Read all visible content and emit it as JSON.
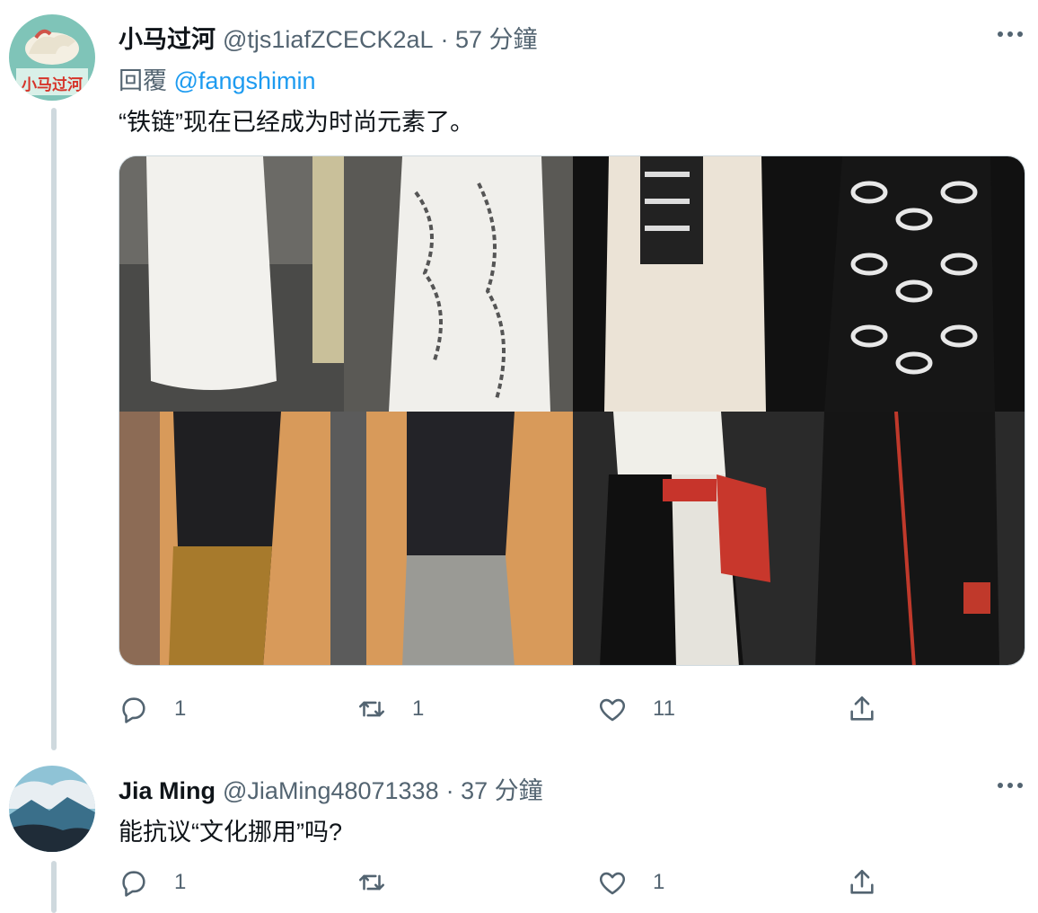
{
  "tweets": [
    {
      "display_name": "小马过河",
      "handle": "@tjs1iafZCECK2aL",
      "time": "· 57 分鐘",
      "reply_prefix": "回覆",
      "reply_mention": "@fangshimin",
      "text": "“铁链”现在已经成为时尚元素了。",
      "media_alt": [
        "runway-white-chain-dresses",
        "runway-black-chain-coat",
        "runway-ruched-dresses",
        "runway-leather-chain-looks"
      ],
      "actions": {
        "reply_count": "1",
        "retweet_count": "1",
        "like_count": "11"
      },
      "avatar_text": "小马过河"
    },
    {
      "display_name": "Jia Ming",
      "handle": "@JiaMing48071338",
      "time": "· 37 分鐘",
      "text": "能抗议“文化挪用”吗?",
      "actions": {
        "reply_count": "1",
        "retweet_count": "",
        "like_count": "1"
      }
    }
  ],
  "icons": [
    "reply-icon",
    "retweet-icon",
    "like-icon",
    "share-icon",
    "more-icon"
  ],
  "colors": {
    "secondary_text": "#536471",
    "link": "#1d9bf0",
    "thread_line": "#cfd9de"
  }
}
